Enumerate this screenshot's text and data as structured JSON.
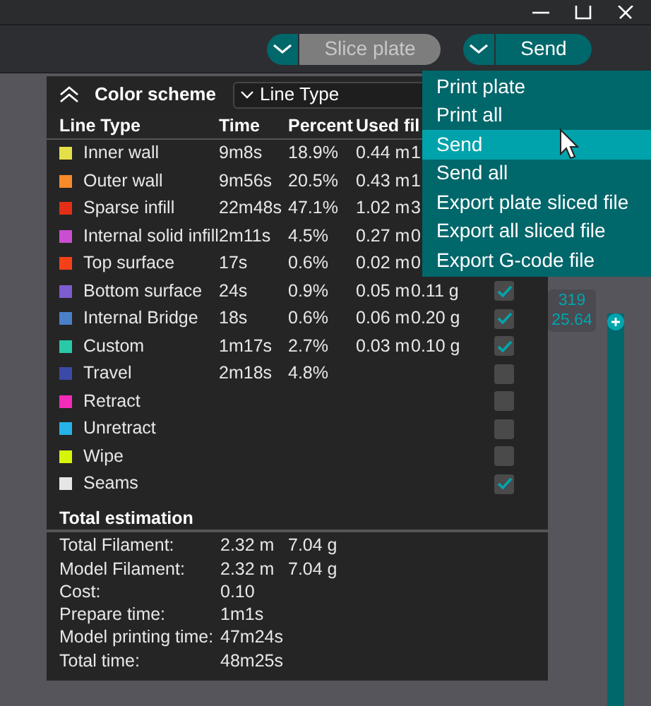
{
  "toolbar": {
    "buttons": [
      {
        "label": "Slice plate",
        "disabled": true
      },
      {
        "label": "Send",
        "disabled": false
      }
    ]
  },
  "color_scheme": {
    "title": "Color scheme",
    "value": "Line Type"
  },
  "table": {
    "columns": [
      "Line Type",
      "Time",
      "Percent",
      "Used fil"
    ],
    "rows": [
      {
        "name": "Inner wall",
        "color": "#e5e04a",
        "time": "9m8s",
        "percent": "18.9%",
        "length": "0.44 m",
        "weight": "1"
      },
      {
        "name": "Outer wall",
        "color": "#f98a2a",
        "time": "9m56s",
        "percent": "20.5%",
        "length": "0.43 m",
        "weight": "1"
      },
      {
        "name": "Sparse infill",
        "color": "#e32f16",
        "time": "22m48s",
        "percent": "47.1%",
        "length": "1.02 m",
        "weight": "3"
      },
      {
        "name": "Internal solid infill",
        "color": "#c94fd0",
        "time": "2m11s",
        "percent": "4.5%",
        "length": "0.27 m",
        "weight": "0"
      },
      {
        "name": "Top surface",
        "color": "#f5411a",
        "time": "17s",
        "percent": "0.6%",
        "length": "0.02 m",
        "weight": "0"
      },
      {
        "name": "Bottom surface",
        "color": "#7d5ccf",
        "time": "24s",
        "percent": "0.9%",
        "length": "0.05 m",
        "weight": "0.11 g",
        "checked": true
      },
      {
        "name": "Internal Bridge",
        "color": "#4a80c8",
        "time": "18s",
        "percent": "0.6%",
        "length": "0.06 m",
        "weight": "0.20 g",
        "checked": true
      },
      {
        "name": "Custom",
        "color": "#27c9a7",
        "time": "1m17s",
        "percent": "2.7%",
        "length": "0.03 m",
        "weight": "0.10 g",
        "checked": true
      },
      {
        "name": "Travel",
        "color": "#3b4aa6",
        "time": "2m18s",
        "percent": "4.8%",
        "checked": false
      },
      {
        "name": "Retract",
        "color": "#f22bb8",
        "checked": false
      },
      {
        "name": "Unretract",
        "color": "#26b2e8",
        "checked": false
      },
      {
        "name": "Wipe",
        "color": "#d6f40a",
        "checked": false
      },
      {
        "name": "Seams",
        "color": "#e6e6e6",
        "checked": true
      }
    ]
  },
  "total_estimation": {
    "title": "Total estimation",
    "rows": [
      {
        "label": "Total Filament:",
        "values": [
          "2.32 m",
          "7.04 g"
        ]
      },
      {
        "label": "Model Filament:",
        "values": [
          "2.32 m",
          "7.04 g"
        ]
      },
      {
        "label": "Cost:",
        "values": [
          "0.10"
        ]
      },
      {
        "label": "Prepare time:",
        "values": [
          "1m1s"
        ]
      },
      {
        "label": "Model printing time:",
        "values": [
          "47m24s"
        ]
      },
      {
        "label": "Total time:",
        "values": [
          "48m25s"
        ]
      }
    ]
  },
  "layer_readout": [
    "319",
    "25.64"
  ],
  "layer_slider": {
    "level": 1
  },
  "menu": {
    "items": [
      {
        "label": "Print plate",
        "selected": false
      },
      {
        "label": "Print all",
        "selected": false
      },
      {
        "label": "Send",
        "selected": true
      },
      {
        "label": "Send all",
        "selected": false
      },
      {
        "label": "Export plate sliced file",
        "selected": false
      },
      {
        "label": "Export all sliced file",
        "selected": false
      },
      {
        "label": "Export G-code file",
        "selected": false
      }
    ]
  }
}
